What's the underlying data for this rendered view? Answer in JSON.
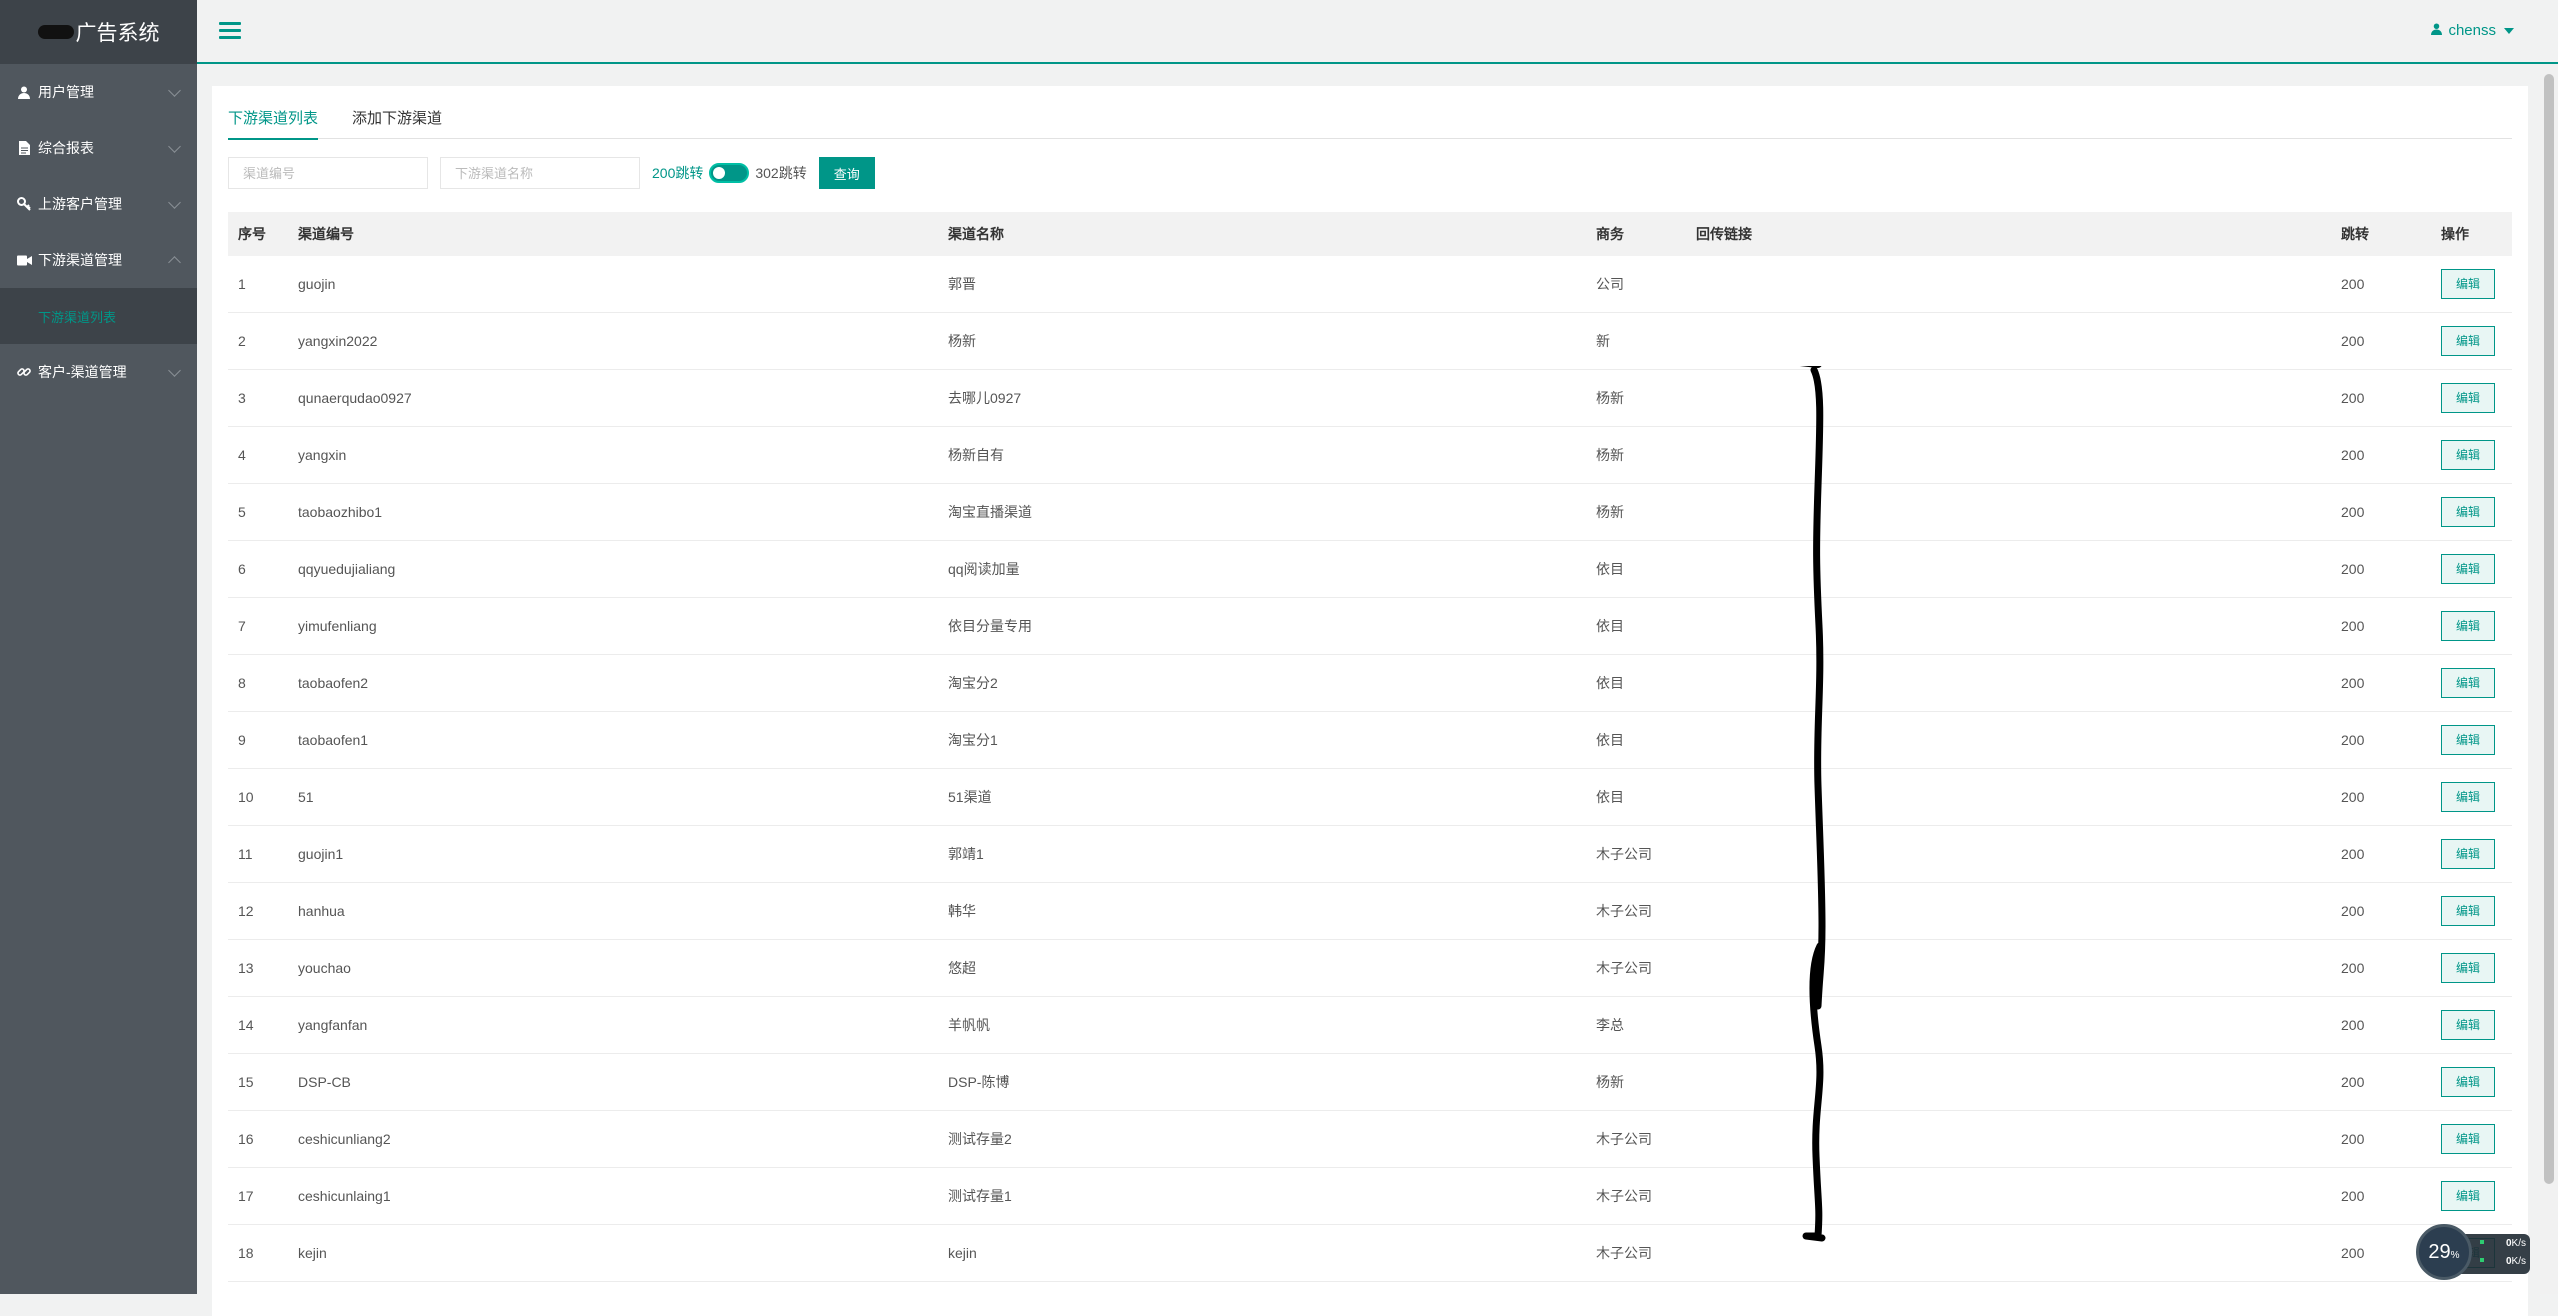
{
  "brand": {
    "title": "广告系统"
  },
  "sidebar": {
    "items": [
      {
        "label": "用户管理",
        "icon": "user-icon"
      },
      {
        "label": "综合报表",
        "icon": "document-icon"
      },
      {
        "label": "上游客户管理",
        "icon": "key-icon"
      },
      {
        "label": "下游渠道管理",
        "icon": "video-icon"
      },
      {
        "label": "客户-渠道管理",
        "icon": "link-icon"
      }
    ],
    "submenu": {
      "label": "下游渠道列表"
    }
  },
  "header": {
    "username": "chenss"
  },
  "tabs": [
    {
      "label": "下游渠道列表"
    },
    {
      "label": "添加下游渠道"
    }
  ],
  "filters": {
    "code_placeholder": "渠道编号",
    "name_placeholder": "下游渠道名称",
    "label_on": "200跳转",
    "label_off": "302跳转",
    "query_label": "查询"
  },
  "table": {
    "headers": {
      "idx": "序号",
      "code": "渠道编号",
      "name": "渠道名称",
      "biz": "商务",
      "back": "回传链接",
      "jump": "跳转",
      "op": "操作"
    },
    "edit_label": "编辑",
    "rows": [
      {
        "idx": "1",
        "code": "guojin",
        "name": "郭晋",
        "biz": "公司",
        "jump": "200"
      },
      {
        "idx": "2",
        "code": "yangxin2022",
        "name": "杨新",
        "biz": "新",
        "jump": "200"
      },
      {
        "idx": "3",
        "code": "qunaerqudao0927",
        "name": "去哪儿0927",
        "biz": "杨新",
        "jump": "200"
      },
      {
        "idx": "4",
        "code": "yangxin",
        "name": "杨新自有",
        "biz": "杨新",
        "jump": "200"
      },
      {
        "idx": "5",
        "code": "taobaozhibo1",
        "name": "淘宝直播渠道",
        "biz": "杨新",
        "jump": "200"
      },
      {
        "idx": "6",
        "code": "qqyuedujialiang",
        "name": "qq阅读加量",
        "biz": "依目",
        "jump": "200"
      },
      {
        "idx": "7",
        "code": "yimufenliang",
        "name": "依目分量专用",
        "biz": "依目",
        "jump": "200"
      },
      {
        "idx": "8",
        "code": "taobaofen2",
        "name": "淘宝分2",
        "biz": "依目",
        "jump": "200"
      },
      {
        "idx": "9",
        "code": "taobaofen1",
        "name": "淘宝分1",
        "biz": "依目",
        "jump": "200"
      },
      {
        "idx": "10",
        "code": "51",
        "name": "51渠道",
        "biz": "依目",
        "jump": "200"
      },
      {
        "idx": "11",
        "code": "guojin1",
        "name": "郭靖1",
        "biz": "木子公司",
        "jump": "200"
      },
      {
        "idx": "12",
        "code": "hanhua",
        "name": "韩华",
        "biz": "木子公司",
        "jump": "200"
      },
      {
        "idx": "13",
        "code": "youchao",
        "name": "悠超",
        "biz": "木子公司",
        "jump": "200"
      },
      {
        "idx": "14",
        "code": "yangfanfan",
        "name": "羊帆帆",
        "biz": "李总",
        "jump": "200"
      },
      {
        "idx": "15",
        "code": "DSP-CB",
        "name": "DSP-陈博",
        "biz": "杨新",
        "jump": "200"
      },
      {
        "idx": "16",
        "code": "ceshicunliang2",
        "name": "测试存量2",
        "biz": "木子公司",
        "jump": "200"
      },
      {
        "idx": "17",
        "code": "ceshicunlaing1",
        "name": "测试存量1",
        "biz": "木子公司",
        "jump": "200"
      },
      {
        "idx": "18",
        "code": "kejin",
        "name": "kejin",
        "biz": "木子公司",
        "jump": "200"
      }
    ]
  },
  "netwidget": {
    "percent": "29",
    "percent_unit": "%",
    "up": "0",
    "down": "0",
    "unit": "K/s"
  },
  "colors": {
    "accent": "#009688",
    "sidebar": "#50575e",
    "sidebar_dark": "#3d4349"
  }
}
